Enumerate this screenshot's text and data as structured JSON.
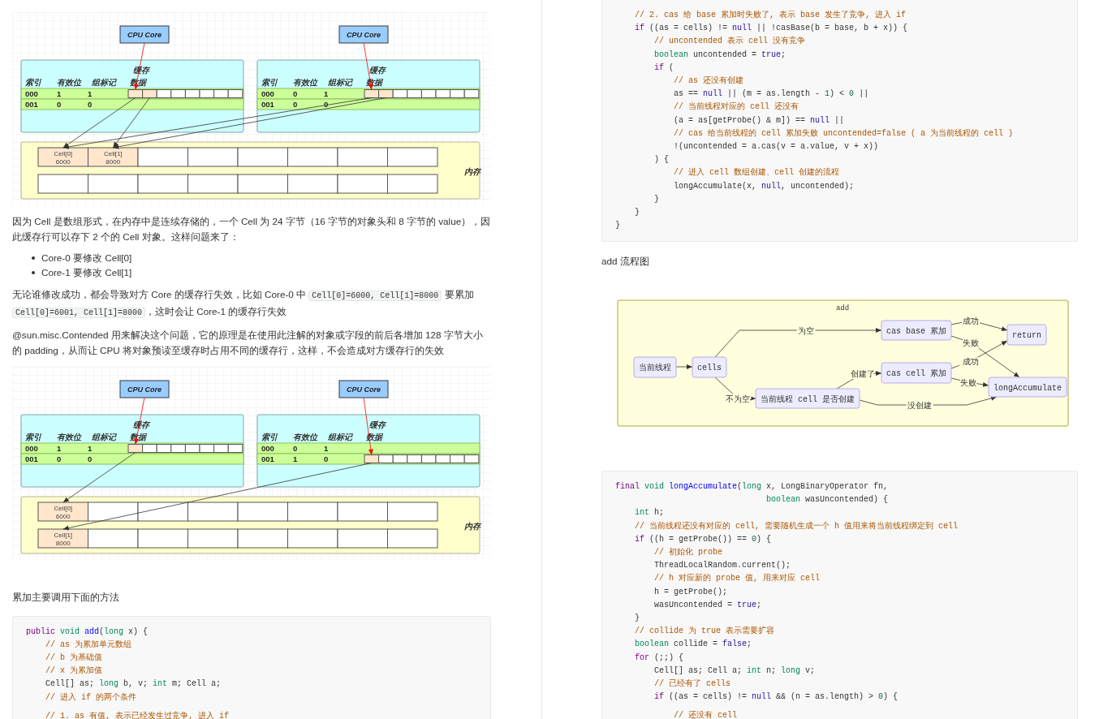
{
  "left_column": {
    "content": [
      {
        "kind": "diagram",
        "cores": [
          {
            "label": "CPU Core"
          },
          {
            "label": "CPU Core"
          }
        ],
        "caches": [
          {
            "title": "缓存",
            "columns": [
              "索引",
              "有效位",
              "组标记",
              "数据"
            ],
            "rows": [
              {
                "cells": [
                  "000",
                  "1",
                  "1"
                ],
                "slots": [
                  {
                    "loaded": true
                  },
                  {
                    "loaded": true
                  },
                  {
                    "loaded": false
                  },
                  {
                    "loaded": false
                  },
                  {
                    "loaded": false
                  },
                  {
                    "loaded": false
                  },
                  {
                    "loaded": false
                  },
                  {
                    "loaded": false
                  }
                ]
              },
              {
                "cells": [
                  "001",
                  "0",
                  "0"
                ]
              }
            ]
          },
          {
            "title": "缓存",
            "columns": [
              "索引",
              "有效位",
              "组标记",
              "数据"
            ],
            "rows": [
              {
                "cells": [
                  "000",
                  "0",
                  "1"
                ],
                "slots": [
                  {
                    "loaded": true
                  },
                  {
                    "loaded": true
                  },
                  {
                    "loaded": false
                  },
                  {
                    "loaded": false
                  },
                  {
                    "loaded": false
                  },
                  {
                    "loaded": false
                  },
                  {
                    "loaded": false
                  },
                  {
                    "loaded": false
                  }
                ]
              },
              {
                "cells": [
                  "001",
                  "0",
                  "0"
                ]
              }
            ]
          }
        ],
        "memory": {
          "label": "内存",
          "rows": [
            {
              "cells": [
                {
                  "loaded": true,
                  "label": "Cell[0]",
                  "value": "6000"
                },
                {
                  "loaded": true,
                  "label": "Cell[1]",
                  "value": "8000"
                },
                {
                  "loaded": false
                },
                {
                  "loaded": false
                },
                {
                  "loaded": false
                },
                {
                  "loaded": false
                },
                {
                  "loaded": false
                },
                {
                  "loaded": false
                }
              ]
            },
            {
              "cells": [
                {
                  "loaded": false
                },
                {
                  "loaded": false
                },
                {
                  "loaded": false
                },
                {
                  "loaded": false
                },
                {
                  "loaded": false
                },
                {
                  "loaded": false
                },
                {
                  "loaded": false
                },
                {
                  "loaded": false
                }
              ]
            }
          ]
        }
      },
      {
        "kind": "paragraph",
        "text": "因为 Cell 是数组形式，在内存中是连续存储的，一个 Cell 为 24 字节（16 字节的对象头和 8 字节的 value），因此缓存行可以存下 2 个的 Cell 对象。这样问题来了："
      },
      {
        "kind": "list",
        "items": [
          "Core-0 要修改 Cell[0]",
          "Core-1 要修改 Cell[1]"
        ]
      },
      {
        "kind": "paragraph",
        "parts": [
          {
            "kind": "text",
            "text": "无论谁修改成功，都会导致对方 Core 的缓存行失效，比如 Core-0 中 "
          },
          {
            "kind": "code",
            "text": "Cell[0]=6000, Cell[1]=8000"
          },
          {
            "kind": "text",
            "text": " 要累加 "
          },
          {
            "kind": "code",
            "text": "Cell[0]=6001, Cell[1]=8000"
          },
          {
            "kind": "text",
            "text": "，这时会让 Core-1 的缓存行失效"
          }
        ]
      },
      {
        "kind": "paragraph",
        "text": "@sun.misc.Contended 用来解决这个问题，它的原理是在使用此注解的对象或字段的前后各增加 128 字节大小的 padding，从而让 CPU 将对象预读至缓存时占用不同的缓存行，这样，不会造成对方缓存行的失效"
      },
      {
        "kind": "diagram",
        "cores": [
          {
            "label": "CPU Core"
          },
          {
            "label": "CPU Core"
          }
        ],
        "caches": [
          {
            "title": "缓存",
            "columns": [
              "索引",
              "有效位",
              "组标记",
              "数据"
            ],
            "rows": [
              {
                "cells": [
                  "000",
                  "1",
                  "1"
                ],
                "slots": [
                  {
                    "loaded": true
                  },
                  {
                    "loaded": false
                  },
                  {
                    "loaded": false
                  },
                  {
                    "loaded": false
                  },
                  {
                    "loaded": false
                  },
                  {
                    "loaded": false
                  },
                  {
                    "loaded": false
                  },
                  {
                    "loaded": false
                  }
                ]
              },
              {
                "cells": [
                  "001",
                  "0",
                  "0"
                ]
              }
            ]
          },
          {
            "title": "缓存",
            "columns": [
              "索引",
              "有效位",
              "组标记",
              "数据"
            ],
            "rows": [
              {
                "cells": [
                  "000",
                  "0",
                  "1"
                ]
              },
              {
                "cells": [
                  "001",
                  "1",
                  "0"
                ],
                "slots": [
                  {
                    "loaded": true
                  },
                  {
                    "loaded": false
                  },
                  {
                    "loaded": false
                  },
                  {
                    "loaded": false
                  },
                  {
                    "loaded": false
                  },
                  {
                    "loaded": false
                  },
                  {
                    "loaded": false
                  },
                  {
                    "loaded": false
                  }
                ]
              }
            ]
          }
        ],
        "memory": {
          "label": "内存",
          "rows": [
            {
              "cells": [
                {
                  "loaded": true,
                  "label": "Cell[0]",
                  "value": "6000"
                },
                {
                  "loaded": false
                },
                {
                  "loaded": false
                },
                {
                  "loaded": false
                },
                {
                  "loaded": false
                },
                {
                  "loaded": false
                },
                {
                  "loaded": false
                },
                {
                  "loaded": false
                }
              ]
            },
            {
              "cells": [
                {
                  "loaded": true,
                  "label": "Cell[1]",
                  "value": "8000"
                },
                {
                  "loaded": false
                },
                {
                  "loaded": false
                },
                {
                  "loaded": false
                },
                {
                  "loaded": false
                },
                {
                  "loaded": false
                },
                {
                  "loaded": false
                },
                {
                  "loaded": false
                }
              ]
            }
          ]
        }
      },
      {
        "kind": "paragraph",
        "text": "累加主要调用下面的方法"
      },
      {
        "kind": "code",
        "groups": [
          [
            [
              {
                "kind": "keyword",
                "text": "public"
              },
              {
                "kind": "type",
                "text": " void"
              },
              {
                "kind": "def",
                "text": " add"
              },
              {
                "text": "("
              },
              {
                "kind": "type",
                "text": "long"
              },
              {
                "text": " x) {"
              }
            ],
            [
              {
                "kind": "comment",
                "text": "    // as 为累加单元数组"
              }
            ],
            [
              {
                "kind": "comment",
                "text": "    // b 为基础值"
              }
            ],
            [
              {
                "kind": "comment",
                "text": "    // x 为累加值"
              }
            ],
            [
              {
                "text": "    Cell[] as; "
              },
              {
                "kind": "type",
                "text": "long"
              },
              {
                "text": " b, v; "
              },
              {
                "kind": "type",
                "text": "int"
              },
              {
                "text": " m; Cell a;"
              }
            ],
            [
              {
                "kind": "comment",
                "text": "    // 进入 if 的两个条件"
              }
            ]
          ],
          [
            [
              {
                "kind": "comment",
                "text": "    // 1. as 有值, 表示已经发生过竞争, 进入 if"
              }
            ]
          ]
        ]
      }
    ]
  },
  "right_column": {
    "content": [
      {
        "kind": "code",
        "groups": [
          [
            [
              {
                "kind": "comment",
                "text": "    // 2. cas 给 base 累加时失败了, 表示 base 发生了竞争, 进入 if"
              }
            ],
            [
              {
                "kind": "keyword",
                "text": "    if"
              },
              {
                "text": " ((as = cells) != "
              },
              {
                "kind": "atom",
                "text": "null"
              },
              {
                "text": " || !casBase(b = base, b + x)) {"
              }
            ],
            [
              {
                "kind": "comment",
                "text": "        // uncontended 表示 cell 没有竞争"
              }
            ],
            [
              {
                "kind": "type",
                "text": "        boolean"
              },
              {
                "text": " uncontended = "
              },
              {
                "kind": "atom",
                "text": "true"
              },
              {
                "text": ";"
              }
            ],
            [
              {
                "kind": "keyword",
                "text": "        if"
              },
              {
                "text": " ("
              }
            ],
            [
              {
                "kind": "comment",
                "text": "            // as 还没有创建"
              }
            ],
            [
              {
                "text": "            as == "
              },
              {
                "kind": "atom",
                "text": "null"
              },
              {
                "text": " || (m = as.length - "
              },
              {
                "kind": "number",
                "text": "1"
              },
              {
                "text": ") < "
              },
              {
                "kind": "number",
                "text": "0"
              },
              {
                "text": " ||"
              }
            ],
            [
              {
                "kind": "comment",
                "text": "            // 当前线程对应的 cell 还没有"
              }
            ],
            [
              {
                "text": "            (a = as[getProbe() & m]) == "
              },
              {
                "kind": "atom",
                "text": "null"
              },
              {
                "text": " ||"
              }
            ],
            [
              {
                "kind": "comment",
                "text": "            // cas 给当前线程的 cell 累加失败 uncontended=false ( a 为当前线程的 cell )"
              }
            ],
            [
              {
                "text": "            !(uncontended = a.cas(v = a.value, v + x))"
              }
            ],
            [
              {
                "text": "        ) {"
              }
            ],
            [
              {
                "kind": "comment",
                "text": "            // 进入 cell 数组创建、cell 创建的流程"
              }
            ],
            [
              {
                "text": "            longAccumulate(x, "
              },
              {
                "kind": "atom",
                "text": "null"
              },
              {
                "text": ", uncontended);"
              }
            ],
            [
              {
                "text": "        }"
              }
            ],
            [
              {
                "text": "    }"
              }
            ],
            [
              {
                "text": "}"
              }
            ]
          ]
        ]
      },
      {
        "kind": "paragraph",
        "text": "add 流程图"
      },
      {
        "kind": "flowchart",
        "title": "add",
        "nodes": [
          {
            "label": "当前线程"
          },
          {
            "label": "cells"
          },
          {
            "label": "cas base 累加"
          },
          {
            "label": "return"
          },
          {
            "label": "cas cell 累加"
          },
          {
            "label": "当前线程 cell 是否创建"
          },
          {
            "label": "longAccumulate"
          }
        ],
        "edge_labels": [
          "为空",
          "成功",
          "失败",
          "成功",
          "创建了",
          "失败",
          "不为空",
          "没创建"
        ]
      },
      {
        "kind": "code",
        "groups": [
          [
            [
              {
                "kind": "keyword",
                "text": "final"
              },
              {
                "kind": "type",
                "text": " void"
              },
              {
                "kind": "def",
                "text": " longAccumulate"
              },
              {
                "text": "("
              },
              {
                "kind": "type",
                "text": "long"
              },
              {
                "text": " x, LongBinaryOperator fn,"
              }
            ],
            [
              {
                "kind": "type",
                "text": "                               boolean"
              },
              {
                "text": " wasUncontended) {"
              }
            ],
            [
              {
                "kind": "type",
                "text": "    int"
              },
              {
                "text": " h;"
              }
            ],
            [
              {
                "kind": "comment",
                "text": "    // 当前线程还没有对应的 cell, 需要随机生成一个 h 值用来将当前线程绑定到 cell"
              }
            ],
            [
              {
                "kind": "keyword",
                "text": "    if"
              },
              {
                "text": " ((h = getProbe()) == "
              },
              {
                "kind": "number",
                "text": "0"
              },
              {
                "text": ") {"
              }
            ],
            [
              {
                "kind": "comment",
                "text": "        // 初始化 probe"
              }
            ],
            [
              {
                "text": "        ThreadLocalRandom.current();"
              }
            ],
            [
              {
                "kind": "comment",
                "text": "        // h 对应新的 probe 值, 用来对应 cell"
              }
            ],
            [
              {
                "text": "        h = getProbe();"
              }
            ],
            [
              {
                "text": "        wasUncontended = "
              },
              {
                "kind": "atom",
                "text": "true"
              },
              {
                "text": ";"
              }
            ],
            [
              {
                "text": "    }"
              }
            ],
            [
              {
                "kind": "comment",
                "text": "    // collide 为 true 表示需要扩容"
              }
            ],
            [
              {
                "kind": "type",
                "text": "    boolean"
              },
              {
                "text": " collide = "
              },
              {
                "kind": "atom",
                "text": "false"
              },
              {
                "text": ";"
              }
            ],
            [
              {
                "kind": "keyword",
                "text": "    for"
              },
              {
                "text": " (;;) {"
              }
            ],
            [
              {
                "text": "        Cell[] as; Cell a; "
              },
              {
                "kind": "type",
                "text": "int"
              },
              {
                "text": " n; "
              },
              {
                "kind": "type",
                "text": "long"
              },
              {
                "text": " v;"
              }
            ],
            [
              {
                "kind": "comment",
                "text": "        // 已经有了 cells"
              }
            ],
            [
              {
                "kind": "keyword",
                "text": "        if"
              },
              {
                "text": " ((as = cells) != "
              },
              {
                "kind": "atom",
                "text": "null"
              },
              {
                "text": " && (n = as.length) > "
              },
              {
                "kind": "number",
                "text": "0"
              },
              {
                "text": ") {"
              }
            ]
          ],
          [
            [
              {
                "kind": "comment",
                "text": "            // 还没有 cell"
              }
            ]
          ]
        ]
      }
    ]
  }
}
